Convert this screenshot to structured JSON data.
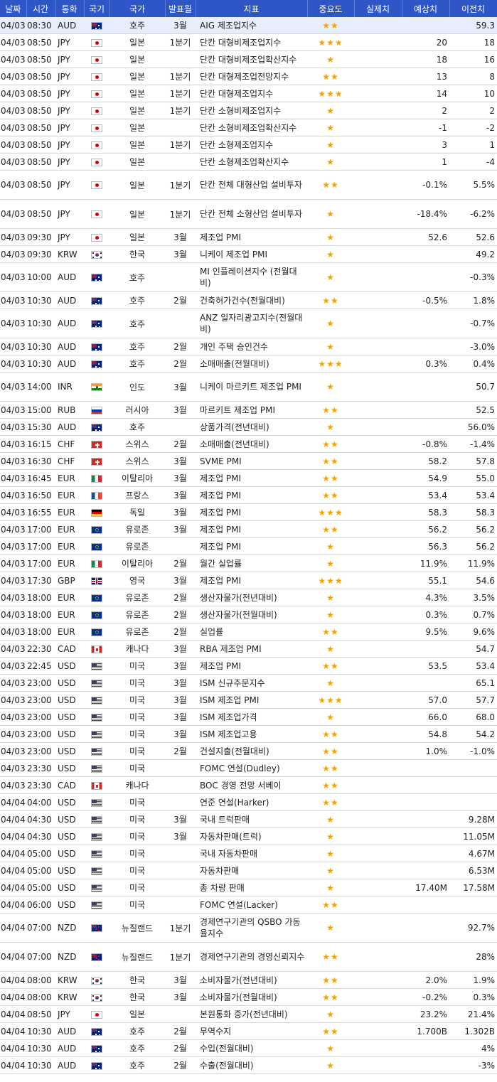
{
  "headers": {
    "date": "날짜",
    "time": "시간",
    "currency": "통화",
    "flag": "국기",
    "country": "국가",
    "period": "발표월",
    "indicator": "지표",
    "importance": "중요도",
    "actual": "실제치",
    "forecast": "예상치",
    "previous": "이전치"
  },
  "colors": {
    "header_bg": "#2e56c7",
    "star": "#f3a300",
    "highlight_row": "#e7eefb"
  },
  "rows": [
    {
      "date": "04/03",
      "time": "08:30",
      "currency": "AUD",
      "flag": "au-flag-icon",
      "country": "호주",
      "period": "3월",
      "indicator": "AIG 제조업지수",
      "importance": "★★",
      "actual": "",
      "forecast": "",
      "previous": "59.3"
    },
    {
      "date": "04/03",
      "time": "08:50",
      "currency": "JPY",
      "flag": "jp-flag-icon",
      "country": "일본",
      "period": "1분기",
      "indicator": "단칸 대형비제조업지수",
      "importance": "★★★",
      "actual": "",
      "forecast": "20",
      "previous": "18"
    },
    {
      "date": "04/03",
      "time": "08:50",
      "currency": "JPY",
      "flag": "jp-flag-icon",
      "country": "일본",
      "period": "",
      "indicator": "단칸 대형비제조업확산지수",
      "importance": "★",
      "actual": "",
      "forecast": "18",
      "previous": "16"
    },
    {
      "date": "04/03",
      "time": "08:50",
      "currency": "JPY",
      "flag": "jp-flag-icon",
      "country": "일본",
      "period": "1분기",
      "indicator": "단칸 대형제조업전망지수",
      "importance": "★★",
      "actual": "",
      "forecast": "13",
      "previous": "8"
    },
    {
      "date": "04/03",
      "time": "08:50",
      "currency": "JPY",
      "flag": "jp-flag-icon",
      "country": "일본",
      "period": "1분기",
      "indicator": "단칸 대형제조업지수",
      "importance": "★★★",
      "actual": "",
      "forecast": "14",
      "previous": "10"
    },
    {
      "date": "04/03",
      "time": "08:50",
      "currency": "JPY",
      "flag": "jp-flag-icon",
      "country": "일본",
      "period": "1분기",
      "indicator": "단칸 소형비제조업지수",
      "importance": "★",
      "actual": "",
      "forecast": "2",
      "previous": "2"
    },
    {
      "date": "04/03",
      "time": "08:50",
      "currency": "JPY",
      "flag": "jp-flag-icon",
      "country": "일본",
      "period": "",
      "indicator": "단칸 소형비제조업확산지수",
      "importance": "★",
      "actual": "",
      "forecast": "-1",
      "previous": "-2"
    },
    {
      "date": "04/03",
      "time": "08:50",
      "currency": "JPY",
      "flag": "jp-flag-icon",
      "country": "일본",
      "period": "1분기",
      "indicator": "단칸 소형제조업지수",
      "importance": "★",
      "actual": "",
      "forecast": "3",
      "previous": "1"
    },
    {
      "date": "04/03",
      "time": "08:50",
      "currency": "JPY",
      "flag": "jp-flag-icon",
      "country": "일본",
      "period": "",
      "indicator": "단칸 소형제조업확산지수",
      "importance": "★",
      "actual": "",
      "forecast": "1",
      "previous": "-4"
    },
    {
      "date": "04/03",
      "time": "08:50",
      "currency": "JPY",
      "flag": "jp-flag-icon",
      "country": "일본",
      "period": "1분기",
      "indicator": "단칸 전체 대형산업 설비투자",
      "importance": "★★",
      "actual": "",
      "forecast": "-0.1%",
      "previous": "5.5%"
    },
    {
      "date": "04/03",
      "time": "08:50",
      "currency": "JPY",
      "flag": "jp-flag-icon",
      "country": "일본",
      "period": "1분기",
      "indicator": "단칸 전체 소형산업 설비투자",
      "importance": "★",
      "actual": "",
      "forecast": "-18.4%",
      "previous": "-6.2%"
    },
    {
      "date": "04/03",
      "time": "09:30",
      "currency": "JPY",
      "flag": "jp-flag-icon",
      "country": "일본",
      "period": "3월",
      "indicator": "제조업 PMI",
      "importance": "★",
      "actual": "",
      "forecast": "52.6",
      "previous": "52.6"
    },
    {
      "date": "04/03",
      "time": "09:30",
      "currency": "KRW",
      "flag": "kr-flag-icon",
      "country": "한국",
      "period": "3월",
      "indicator": "니케이 제조업 PMI",
      "importance": "★",
      "actual": "",
      "forecast": "",
      "previous": "49.2"
    },
    {
      "date": "04/03",
      "time": "10:00",
      "currency": "AUD",
      "flag": "au-flag-icon",
      "country": "호주",
      "period": "",
      "indicator": "MI 인플레이션지수 (전월대비)",
      "importance": "★",
      "actual": "",
      "forecast": "",
      "previous": "-0.3%"
    },
    {
      "date": "04/03",
      "time": "10:30",
      "currency": "AUD",
      "flag": "au-flag-icon",
      "country": "호주",
      "period": "2월",
      "indicator": "건축허가건수(전월대비)",
      "importance": "★★",
      "actual": "",
      "forecast": "-0.5%",
      "previous": "1.8%"
    },
    {
      "date": "04/03",
      "time": "10:30",
      "currency": "AUD",
      "flag": "au-flag-icon",
      "country": "호주",
      "period": "",
      "indicator": "ANZ 일자리광고지수(전월대비)",
      "importance": "★",
      "actual": "",
      "forecast": "",
      "previous": "-0.7%"
    },
    {
      "date": "04/03",
      "time": "10:30",
      "currency": "AUD",
      "flag": "au-flag-icon",
      "country": "호주",
      "period": "2월",
      "indicator": "개인 주택 승인건수",
      "importance": "★",
      "actual": "",
      "forecast": "",
      "previous": "-3.0%"
    },
    {
      "date": "04/03",
      "time": "10:30",
      "currency": "AUD",
      "flag": "au-flag-icon",
      "country": "호주",
      "period": "2월",
      "indicator": "소매매출(전월대비)",
      "importance": "★★★",
      "actual": "",
      "forecast": "0.3%",
      "previous": "0.4%"
    },
    {
      "date": "04/03",
      "time": "14:00",
      "currency": "INR",
      "flag": "in-flag-icon",
      "country": "인도",
      "period": "3월",
      "indicator": "니케이 마르키트 제조업 PMI",
      "importance": "★",
      "actual": "",
      "forecast": "",
      "previous": "50.7"
    },
    {
      "date": "04/03",
      "time": "15:00",
      "currency": "RUB",
      "flag": "ru-flag-icon",
      "country": "러시아",
      "period": "3월",
      "indicator": "마르키트 제조업 PMI",
      "importance": "★★",
      "actual": "",
      "forecast": "",
      "previous": "52.5"
    },
    {
      "date": "04/03",
      "time": "15:30",
      "currency": "AUD",
      "flag": "au-flag-icon",
      "country": "호주",
      "period": "",
      "indicator": "상품가격(전년대비)",
      "importance": "★",
      "actual": "",
      "forecast": "",
      "previous": "56.0%"
    },
    {
      "date": "04/03",
      "time": "16:15",
      "currency": "CHF",
      "flag": "ch-flag-icon",
      "country": "스위스",
      "period": "2월",
      "indicator": "소매매출(전년대비)",
      "importance": "★★",
      "actual": "",
      "forecast": "-0.8%",
      "previous": "-1.4%"
    },
    {
      "date": "04/03",
      "time": "16:30",
      "currency": "CHF",
      "flag": "ch-flag-icon",
      "country": "스위스",
      "period": "3월",
      "indicator": "SVME PMI",
      "importance": "★★",
      "actual": "",
      "forecast": "58.2",
      "previous": "57.8"
    },
    {
      "date": "04/03",
      "time": "16:45",
      "currency": "EUR",
      "flag": "it-flag-icon",
      "country": "이탈리아",
      "period": "3월",
      "indicator": "제조업 PMI",
      "importance": "★★",
      "actual": "",
      "forecast": "54.9",
      "previous": "55.0"
    },
    {
      "date": "04/03",
      "time": "16:50",
      "currency": "EUR",
      "flag": "fr-flag-icon",
      "country": "프랑스",
      "period": "3월",
      "indicator": "제조업 PMI",
      "importance": "★★",
      "actual": "",
      "forecast": "53.4",
      "previous": "53.4"
    },
    {
      "date": "04/03",
      "time": "16:55",
      "currency": "EUR",
      "flag": "de-flag-icon",
      "country": "독일",
      "period": "3월",
      "indicator": "제조업 PMI",
      "importance": "★★★",
      "actual": "",
      "forecast": "58.3",
      "previous": "58.3"
    },
    {
      "date": "04/03",
      "time": "17:00",
      "currency": "EUR",
      "flag": "eu-flag-icon",
      "country": "유로존",
      "period": "3월",
      "indicator": "제조업 PMI",
      "importance": "★★",
      "actual": "",
      "forecast": "56.2",
      "previous": "56.2"
    },
    {
      "date": "04/03",
      "time": "17:00",
      "currency": "EUR",
      "flag": "eu-flag-icon",
      "country": "유로존",
      "period": "",
      "indicator": "제조업 PMI",
      "importance": "★",
      "actual": "",
      "forecast": "56.3",
      "previous": "56.2"
    },
    {
      "date": "04/03",
      "time": "17:00",
      "currency": "EUR",
      "flag": "it-flag-icon",
      "country": "이탈리아",
      "period": "2월",
      "indicator": "월간 실업률",
      "importance": "★",
      "actual": "",
      "forecast": "11.9%",
      "previous": "11.9%"
    },
    {
      "date": "04/03",
      "time": "17:30",
      "currency": "GBP",
      "flag": "gb-flag-icon",
      "country": "영국",
      "period": "3월",
      "indicator": "제조업 PMI",
      "importance": "★★★",
      "actual": "",
      "forecast": "55.1",
      "previous": "54.6"
    },
    {
      "date": "04/03",
      "time": "18:00",
      "currency": "EUR",
      "flag": "eu-flag-icon",
      "country": "유로존",
      "period": "2월",
      "indicator": "생산자물가(전년대비)",
      "importance": "★",
      "actual": "",
      "forecast": "4.3%",
      "previous": "3.5%"
    },
    {
      "date": "04/03",
      "time": "18:00",
      "currency": "EUR",
      "flag": "eu-flag-icon",
      "country": "유로존",
      "period": "2월",
      "indicator": "생산자물가(전월대비)",
      "importance": "★",
      "actual": "",
      "forecast": "0.3%",
      "previous": "0.7%"
    },
    {
      "date": "04/03",
      "time": "18:00",
      "currency": "EUR",
      "flag": "eu-flag-icon",
      "country": "유로존",
      "period": "2월",
      "indicator": "실업률",
      "importance": "★★",
      "actual": "",
      "forecast": "9.5%",
      "previous": "9.6%"
    },
    {
      "date": "04/03",
      "time": "22:30",
      "currency": "CAD",
      "flag": "ca-flag-icon",
      "country": "캐나다",
      "period": "3월",
      "indicator": "RBA 제조업 PMI",
      "importance": "★",
      "actual": "",
      "forecast": "",
      "previous": "54.7"
    },
    {
      "date": "04/03",
      "time": "22:45",
      "currency": "USD",
      "flag": "us-flag-icon",
      "country": "미국",
      "period": "3월",
      "indicator": "제조업 PMI",
      "importance": "★★",
      "actual": "",
      "forecast": "53.5",
      "previous": "53.4"
    },
    {
      "date": "04/03",
      "time": "23:00",
      "currency": "USD",
      "flag": "us-flag-icon",
      "country": "미국",
      "period": "3월",
      "indicator": "ISM 신규주문지수",
      "importance": "★",
      "actual": "",
      "forecast": "",
      "previous": "65.1"
    },
    {
      "date": "04/03",
      "time": "23:00",
      "currency": "USD",
      "flag": "us-flag-icon",
      "country": "미국",
      "period": "3월",
      "indicator": "ISM 제조업 PMI",
      "importance": "★★★",
      "actual": "",
      "forecast": "57.0",
      "previous": "57.7"
    },
    {
      "date": "04/03",
      "time": "23:00",
      "currency": "USD",
      "flag": "us-flag-icon",
      "country": "미국",
      "period": "3월",
      "indicator": "ISM 제조업가격",
      "importance": "★",
      "actual": "",
      "forecast": "66.0",
      "previous": "68.0"
    },
    {
      "date": "04/03",
      "time": "23:00",
      "currency": "USD",
      "flag": "us-flag-icon",
      "country": "미국",
      "period": "3월",
      "indicator": "ISM 제조업고용",
      "importance": "★★",
      "actual": "",
      "forecast": "54.8",
      "previous": "54.2"
    },
    {
      "date": "04/03",
      "time": "23:00",
      "currency": "USD",
      "flag": "us-flag-icon",
      "country": "미국",
      "period": "2월",
      "indicator": "건설지출(전월대비)",
      "importance": "★★",
      "actual": "",
      "forecast": "1.0%",
      "previous": "-1.0%"
    },
    {
      "date": "04/03",
      "time": "23:30",
      "currency": "USD",
      "flag": "us-flag-icon",
      "country": "미국",
      "period": "",
      "indicator": "FOMC 연설(Dudley)",
      "importance": "★★",
      "actual": "",
      "forecast": "",
      "previous": ""
    },
    {
      "date": "04/03",
      "time": "23:30",
      "currency": "CAD",
      "flag": "ca-flag-icon",
      "country": "캐나다",
      "period": "",
      "indicator": "BOC 경영 전망 서베이",
      "importance": "★★",
      "actual": "",
      "forecast": "",
      "previous": ""
    },
    {
      "date": "04/04",
      "time": "04:00",
      "currency": "USD",
      "flag": "us-flag-icon",
      "country": "미국",
      "period": "",
      "indicator": "연준 연설(Harker)",
      "importance": "★★",
      "actual": "",
      "forecast": "",
      "previous": ""
    },
    {
      "date": "04/04",
      "time": "04:30",
      "currency": "USD",
      "flag": "us-flag-icon",
      "country": "미국",
      "period": "3월",
      "indicator": "국내 트럭판매",
      "importance": "★",
      "actual": "",
      "forecast": "",
      "previous": "9.28M"
    },
    {
      "date": "04/04",
      "time": "04:30",
      "currency": "USD",
      "flag": "us-flag-icon",
      "country": "미국",
      "period": "3월",
      "indicator": "자동차판매(트럭)",
      "importance": "★",
      "actual": "",
      "forecast": "",
      "previous": "11.05M"
    },
    {
      "date": "04/04",
      "time": "05:00",
      "currency": "USD",
      "flag": "us-flag-icon",
      "country": "미국",
      "period": "",
      "indicator": "국내 자동차판매",
      "importance": "★",
      "actual": "",
      "forecast": "",
      "previous": "4.67M"
    },
    {
      "date": "04/04",
      "time": "05:00",
      "currency": "USD",
      "flag": "us-flag-icon",
      "country": "미국",
      "period": "",
      "indicator": "자동차판매",
      "importance": "★",
      "actual": "",
      "forecast": "",
      "previous": "6.53M"
    },
    {
      "date": "04/04",
      "time": "05:00",
      "currency": "USD",
      "flag": "us-flag-icon",
      "country": "미국",
      "period": "",
      "indicator": "총 차량 판매",
      "importance": "★",
      "actual": "",
      "forecast": "17.40M",
      "previous": "17.58M"
    },
    {
      "date": "04/04",
      "time": "06:00",
      "currency": "USD",
      "flag": "us-flag-icon",
      "country": "미국",
      "period": "",
      "indicator": "FOMC 연설(Lacker)",
      "importance": "★★",
      "actual": "",
      "forecast": "",
      "previous": ""
    },
    {
      "date": "04/04",
      "time": "07:00",
      "currency": "NZD",
      "flag": "nz-flag-icon",
      "country": "뉴질랜드",
      "period": "1분기",
      "indicator": "경제연구기관의 QSBO 가동율지수",
      "importance": "★",
      "actual": "",
      "forecast": "",
      "previous": "92.7%"
    },
    {
      "date": "04/04",
      "time": "07:00",
      "currency": "NZD",
      "flag": "nz-flag-icon",
      "country": "뉴질랜드",
      "period": "1분기",
      "indicator": "경제연구기관의 경영신뢰지수",
      "importance": "★★",
      "actual": "",
      "forecast": "",
      "previous": "28%"
    },
    {
      "date": "04/04",
      "time": "08:00",
      "currency": "KRW",
      "flag": "kr-flag-icon",
      "country": "한국",
      "period": "3월",
      "indicator": "소비자물가(전년대비)",
      "importance": "★★",
      "actual": "",
      "forecast": "2.0%",
      "previous": "1.9%"
    },
    {
      "date": "04/04",
      "time": "08:00",
      "currency": "KRW",
      "flag": "kr-flag-icon",
      "country": "한국",
      "period": "3월",
      "indicator": "소비자물가(전월대비)",
      "importance": "★★",
      "actual": "",
      "forecast": "-0.2%",
      "previous": "0.3%"
    },
    {
      "date": "04/04",
      "time": "08:50",
      "currency": "JPY",
      "flag": "jp-flag-icon",
      "country": "일본",
      "period": "",
      "indicator": "본원통화 증가(전년대비)",
      "importance": "★",
      "actual": "",
      "forecast": "23.2%",
      "previous": "21.4%"
    },
    {
      "date": "04/04",
      "time": "10:30",
      "currency": "AUD",
      "flag": "au-flag-icon",
      "country": "호주",
      "period": "2월",
      "indicator": "무역수지",
      "importance": "★★",
      "actual": "",
      "forecast": "1.700B",
      "previous": "1.302B"
    },
    {
      "date": "04/04",
      "time": "10:30",
      "currency": "AUD",
      "flag": "au-flag-icon",
      "country": "호주",
      "period": "2월",
      "indicator": "수입(전월대비)",
      "importance": "★",
      "actual": "",
      "forecast": "",
      "previous": "4%"
    },
    {
      "date": "04/04",
      "time": "10:30",
      "currency": "AUD",
      "flag": "au-flag-icon",
      "country": "호주",
      "period": "2월",
      "indicator": "수출(전월대비)",
      "importance": "★",
      "actual": "",
      "forecast": "",
      "previous": "-3%"
    }
  ]
}
